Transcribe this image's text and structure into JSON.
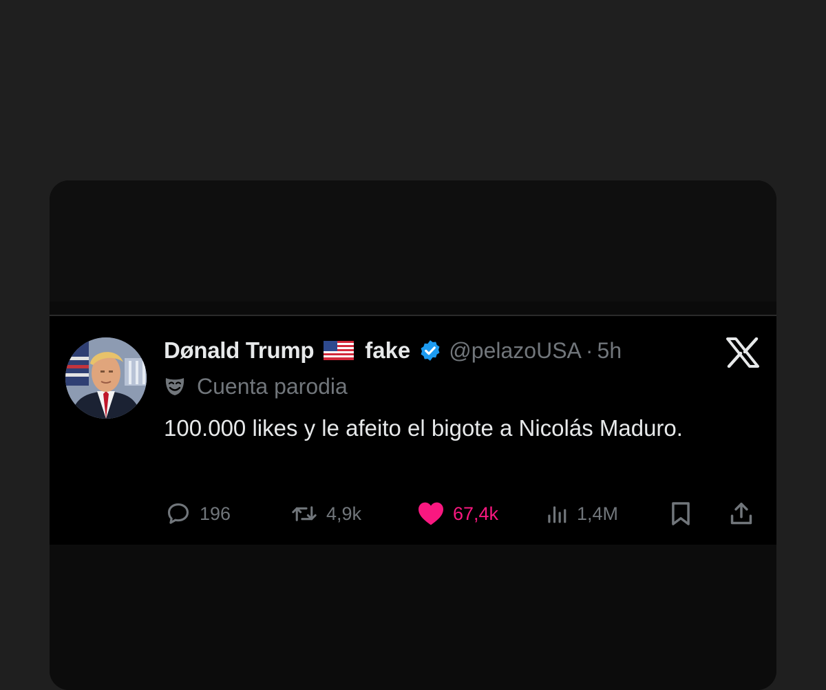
{
  "tweet": {
    "display_name": "Dønald Trump",
    "label": "fake",
    "handle": "@pelazoUSA",
    "separator": "·",
    "time": "5h",
    "parody_label": "Cuenta parodia",
    "text": "100.000 likes y le afeito el bigote a Nicolás Maduro.",
    "icons": {
      "flag": "us-flag-icon",
      "verified": "verified-badge-icon",
      "platform": "x-logo-icon",
      "parody": "parody-mask-icon"
    }
  },
  "actions": {
    "replies": "196",
    "reposts": "4,9k",
    "likes": "67,4k",
    "views": "1,4M"
  },
  "colors": {
    "background": "#1f1f1f",
    "tweet_background": "#000000",
    "primary_text": "#e7e9ea",
    "secondary_text": "#71767b",
    "like_pink": "#f91880",
    "verified_blue": "#1d9bf0"
  }
}
